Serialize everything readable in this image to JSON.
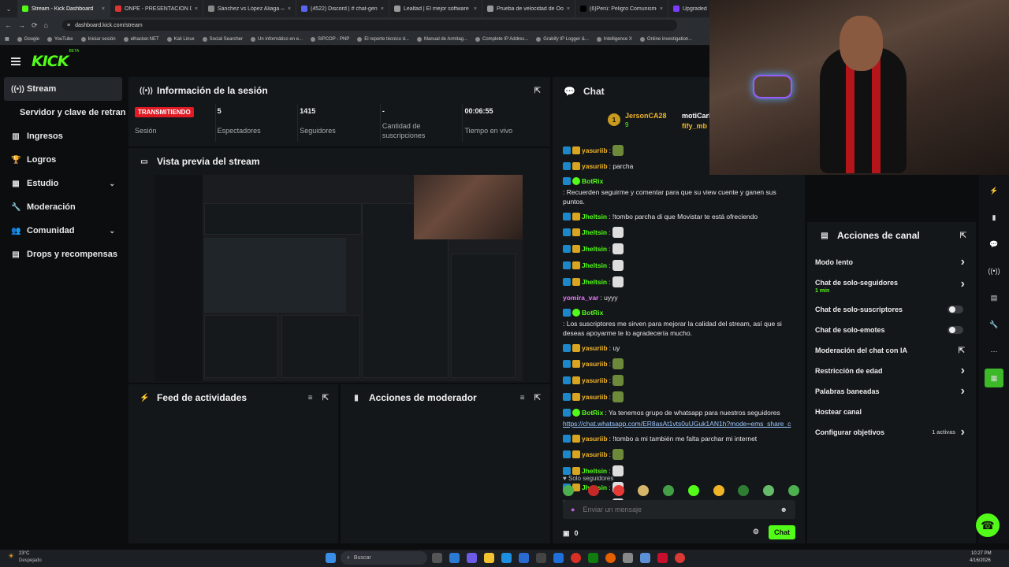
{
  "browser": {
    "tabs": [
      {
        "label": "Stream - Kick Dashboard",
        "color": "#53fc18",
        "active": true
      },
      {
        "label": "ONPE - PRESENTACIÓN DE RE",
        "color": "#d33"
      },
      {
        "label": "Sánchez vs López Aliaga — ¿Q",
        "color": "#888"
      },
      {
        "label": "(4522) Discord | # chat-gene",
        "color": "#5865f2"
      },
      {
        "label": "Lealtad | El mejor software para",
        "color": "#999"
      },
      {
        "label": "Prueba de velocidad de Ookla",
        "color": "#999"
      },
      {
        "label": "(6)Perú: Peligro Comunismo y V",
        "color": "#000"
      },
      {
        "label": "Upgraded",
        "color": "#7a3cff"
      }
    ],
    "url": "dashboard.kick.com/stream",
    "bookmarks": [
      "Google",
      "YouTube",
      "Iniciar sesión",
      "elhacker.NET",
      "Kali Linux",
      "Social Searcher",
      "Un informático en e...",
      "SIPCOP - PNP",
      "El reporte técnico d...",
      "Manual de Armitag...",
      "Complete IP Addres...",
      "Grabify IP Logger &...",
      "Intelligence X",
      "Online investigation..."
    ]
  },
  "kick": {
    "logo": "KICK",
    "beta": "BETA"
  },
  "sidebar": {
    "items": [
      {
        "label": "Stream",
        "icon": "stream-icon",
        "glyph": "((•))"
      },
      {
        "label": "Servidor y clave de retransmisión",
        "sub": true
      },
      {
        "label": "Ingresos",
        "icon": "chart-icon",
        "glyph": "▥"
      },
      {
        "label": "Logros",
        "icon": "trophy-icon",
        "glyph": "🏆"
      },
      {
        "label": "Estudio",
        "icon": "studio-icon",
        "glyph": "▦",
        "chevron": true
      },
      {
        "label": "Moderación",
        "icon": "wrench-icon",
        "glyph": "🔧"
      },
      {
        "label": "Comunidad",
        "icon": "community-icon",
        "glyph": "👥",
        "chevron": true
      },
      {
        "label": "Drops y recompensas",
        "icon": "drops-icon",
        "glyph": "▤"
      }
    ]
  },
  "session": {
    "title": "Información de la sesión",
    "status": "TRANSMITIENDO",
    "session_label": "Sesión",
    "viewers": "5",
    "viewers_label": "Espectadores",
    "followers": "1415",
    "followers_label": "Seguidores",
    "subs": "-",
    "subs_label": "Cantidad de suscripciones",
    "time": "00:06:55",
    "time_label": "Tiempo en vivo"
  },
  "preview": {
    "title": "Vista previa del stream"
  },
  "feed": {
    "title": "Feed de actividades"
  },
  "modactions": {
    "title": "Acciones de moderador"
  },
  "chat": {
    "title": "Chat",
    "pinned_user": "JersonCA28",
    "pinned_count": "9",
    "pinned_user2": "motiCarl",
    "pinned_user3": "fify_mb",
    "messages": [
      {
        "user": "yasuriib",
        "color": "#f0b429",
        "text": ":",
        "emote": "#6d8a3a",
        "badges": "sg"
      },
      {
        "user": "yasuriib",
        "color": "#f0b429",
        "text": ": parcha",
        "badges": "sg"
      },
      {
        "user": "BotRix",
        "color": "#53fc18",
        "text": ": Recuerden seguirme y comentar para que su view cuente y ganen sus puntos.",
        "badges": "sv"
      },
      {
        "user": "Jheltsin",
        "color": "#53fc18",
        "text": ": !tombo parcha di que Movistar te está ofreciendo",
        "badges": "sg"
      },
      {
        "user": "Jheltsin",
        "color": "#53fc18",
        "text": ":",
        "emote": "#ddd",
        "badges": "sg"
      },
      {
        "user": "Jheltsin",
        "color": "#53fc18",
        "text": ":",
        "emote": "#ddd",
        "badges": "sg"
      },
      {
        "user": "Jheltsin",
        "color": "#53fc18",
        "text": ":",
        "emote": "#ddd",
        "badges": "sg"
      },
      {
        "user": "Jheltsin",
        "color": "#53fc18",
        "text": ":",
        "emote": "#ddd",
        "badges": "sg"
      },
      {
        "user": "yomira_var",
        "color": "#e879f9",
        "text": ": uyyy",
        "badges": ""
      },
      {
        "user": "BotRix",
        "color": "#53fc18",
        "text": ": Los suscriptores me sirven para mejorar la calidad del stream, así que si deseas apoyarme te lo agradecería mucho.",
        "badges": "sv"
      },
      {
        "user": "yasuriib",
        "color": "#f0b429",
        "text": ": uy",
        "badges": "sg"
      },
      {
        "user": "yasuriib",
        "color": "#f0b429",
        "text": ":",
        "emote": "#6d8a3a",
        "badges": "sg"
      },
      {
        "user": "yasuriib",
        "color": "#f0b429",
        "text": ":",
        "emote": "#6d8a3a",
        "badges": "sg"
      },
      {
        "user": "yasuriib",
        "color": "#f0b429",
        "text": ":",
        "emote": "#6d8a3a",
        "badges": "sg"
      },
      {
        "user": "BotRix",
        "color": "#53fc18",
        "text": ": Ya tenemos grupo de whatsapp para nuestros seguidores",
        "link": "https://chat.whatsapp.com/ER8asAt1vts0uUGuk1AN1h?mode=ems_share_c",
        "badges": "sv"
      },
      {
        "user": "yasuriib",
        "color": "#f0b429",
        "text": ": !tombo a mi también me falta parchar mi internet",
        "badges": "sg"
      },
      {
        "user": "yasuriib",
        "color": "#f0b429",
        "text": ":",
        "emote": "#6d8a3a",
        "badges": "sg"
      },
      {
        "user": "Jheltsin",
        "color": "#53fc18",
        "text": ":",
        "emote": "#ddd",
        "badges": "sg"
      },
      {
        "user": "Jheltsin",
        "color": "#53fc18",
        "text": ":",
        "emote": "#ddd",
        "badges": "sg"
      },
      {
        "user": "Jheltsin",
        "color": "#53fc18",
        "text": ":",
        "emote": "#ddd",
        "badges": "sg"
      }
    ],
    "followers_only": "Solo seguidores",
    "emote_bar": [
      "#4caf50",
      "#c62828",
      "#e53935",
      "#d4b56a",
      "#43a047",
      "#53fc18",
      "#f0b429",
      "#2e7d32",
      "#66bb6a",
      "#4caf50"
    ],
    "placeholder": "Enviar un mensaje",
    "count": "0",
    "send": "Chat"
  },
  "acciones": {
    "title": "Acciones de canal",
    "rows": [
      {
        "label": "Modo lento",
        "type": "chevron"
      },
      {
        "label": "Chat de solo-seguidores",
        "sub": "1 min",
        "type": "chevron"
      },
      {
        "label": "Chat de solo-suscriptores",
        "type": "toggle"
      },
      {
        "label": "Chat de solo-emotes",
        "type": "toggle"
      },
      {
        "label": "Moderación del chat con IA",
        "type": "external"
      },
      {
        "label": "Restricción de edad",
        "type": "chevron"
      },
      {
        "label": "Palabras baneadas",
        "type": "chevron"
      },
      {
        "label": "Hostear canal",
        "type": "none"
      },
      {
        "label": "Configurar objetivos",
        "type": "chevron",
        "extra": "1 activas"
      }
    ]
  },
  "taskbar": {
    "weather_temp": "23°C",
    "weather_label": "Despejado",
    "search": "Buscar",
    "time": "10:27 PM",
    "date": "4/16/2026"
  },
  "colors": {
    "accent": "#53fc18",
    "live": "#e01b24",
    "panel": "#14171a"
  }
}
